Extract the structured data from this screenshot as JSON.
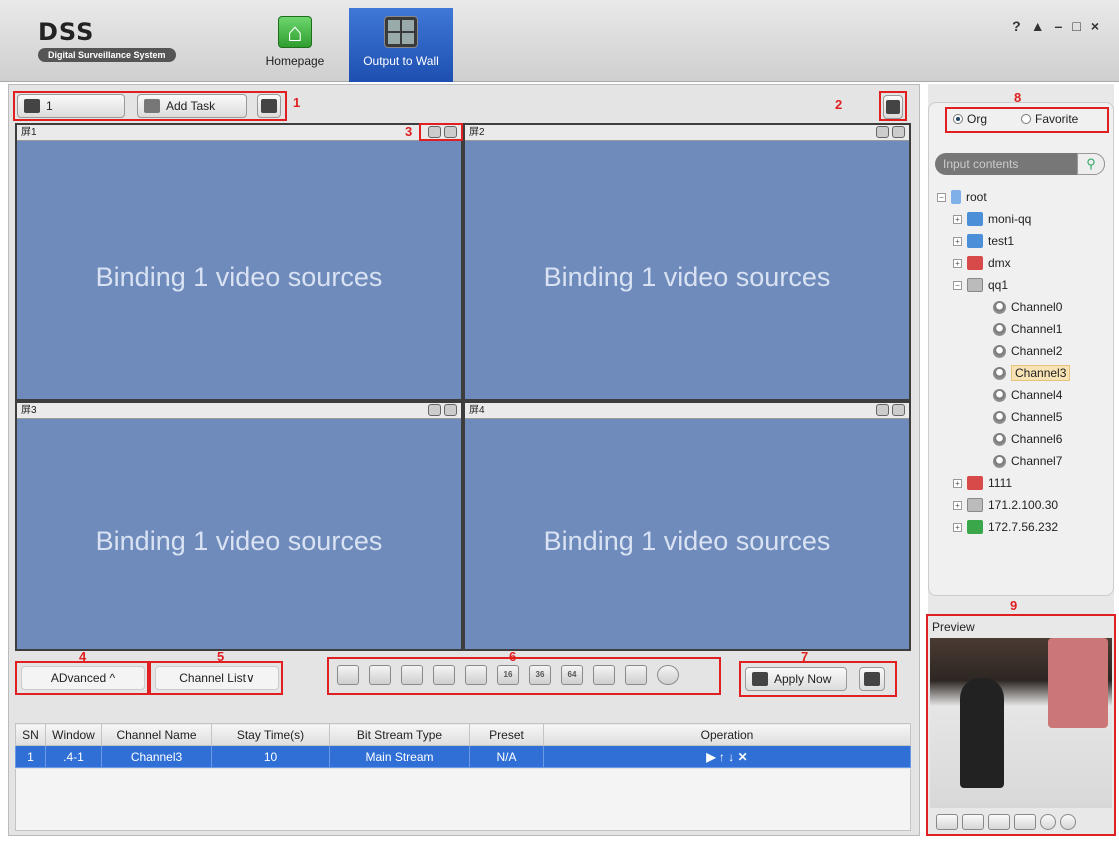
{
  "app": {
    "logo_title": "DSS",
    "logo_subtitle": "Digital Surveillance System",
    "nav": [
      {
        "label": "Homepage",
        "icon": "home-icon"
      },
      {
        "label": "Output to Wall",
        "icon": "video-wall-icon",
        "active": true
      }
    ],
    "window_controls": [
      "?",
      "lock",
      "minimize",
      "restore",
      "close"
    ]
  },
  "toolbar": {
    "wall_select_value": "1",
    "add_task_label": "Add Task",
    "marker_1": "1",
    "marker_2": "2",
    "marker_3": "3"
  },
  "screens": [
    {
      "name": "屏1",
      "text": "Binding 1 video sources"
    },
    {
      "name": "屏2",
      "text": "Binding 1 video sources"
    },
    {
      "name": "屏3",
      "text": "Binding 1 video sources"
    },
    {
      "name": "屏4",
      "text": "Binding 1 video sources"
    }
  ],
  "bottom": {
    "marker_4": "4",
    "marker_5": "5",
    "marker_6": "6",
    "marker_7": "7",
    "advanced_label": "ADvanced ^",
    "channel_list_label": "Channel List∨",
    "apply_now_label": "Apply Now",
    "layout_buttons": [
      "1",
      "4",
      "6",
      "8",
      "9",
      "16",
      "36",
      "64",
      "custom",
      "clear",
      "power"
    ],
    "layout_labels": {
      "b16": "16",
      "b36": "36",
      "b64": "64"
    }
  },
  "table": {
    "columns": [
      "SN",
      "Window",
      "Channel Name",
      "Stay Time(s)",
      "Bit Stream Type",
      "Preset",
      "Operation"
    ],
    "rows": [
      {
        "sn": "1",
        "window": ".4-1",
        "channel": "Channel3",
        "stay": "10",
        "stream": "Main Stream",
        "preset": "N/A",
        "operation": "▶ ↑ ↓ ✕"
      }
    ]
  },
  "right_panel": {
    "marker_8": "8",
    "marker_9": "9",
    "radio_org": "Org",
    "radio_favorite": "Favorite",
    "search_placeholder": "Input contents",
    "tree": {
      "root": "root",
      "n_moni": "moni-qq",
      "n_test1": "test1",
      "n_dmx": "dmx",
      "n_qq1": "qq1",
      "channels": [
        "Channel0",
        "Channel1",
        "Channel2",
        "Channel3",
        "Channel4",
        "Channel5",
        "Channel6",
        "Channel7"
      ],
      "n_1111": "1111",
      "n_ip1": "171.2.100.30",
      "n_ip2": "172.7.56.232"
    },
    "selected_channel": "Channel3",
    "preview_title": "Preview"
  }
}
